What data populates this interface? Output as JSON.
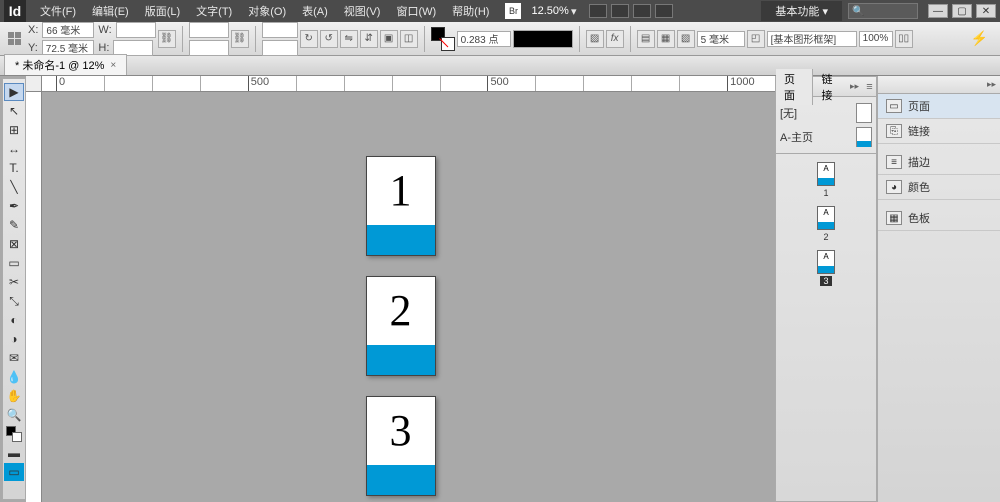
{
  "menubar": {
    "logo": "Id",
    "items": [
      "文件(F)",
      "编辑(E)",
      "版面(L)",
      "文字(T)",
      "对象(O)",
      "表(A)",
      "视图(V)",
      "窗口(W)",
      "帮助(H)"
    ],
    "zoom": "12.50%",
    "workspace": "基本功能",
    "search_placeholder": "🔍"
  },
  "controlbar": {
    "x_label": "X:",
    "x_value": "66 毫米",
    "y_label": "Y:",
    "y_value": "72.5 毫米",
    "w_label": "W:",
    "w_value": "",
    "h_label": "H:",
    "h_value": "",
    "stroke_weight": "0.283 点",
    "opacity": "100%",
    "gap": "5 毫米",
    "style": "[基本图形框架]"
  },
  "tab": {
    "title": "* 未命名-1 @ 12%",
    "close": "×"
  },
  "ruler_labels": [
    "0",
    "500",
    "1000"
  ],
  "canvas_pages": [
    {
      "num": "1"
    },
    {
      "num": "2"
    },
    {
      "num": "3"
    }
  ],
  "pages_panel": {
    "tabs": [
      "页面",
      "链接"
    ],
    "masters": [
      {
        "label": "[无]",
        "band": false
      },
      {
        "label": "A-主页",
        "band": true
      }
    ],
    "thumbs": [
      {
        "letter": "A",
        "label": "1",
        "selected": false
      },
      {
        "letter": "A",
        "label": "2",
        "selected": false
      },
      {
        "letter": "A",
        "label": "3",
        "selected": true
      }
    ]
  },
  "collapsed_panels": {
    "items": [
      {
        "icon": "▭",
        "label": "页面",
        "active": true
      },
      {
        "icon": "⎘",
        "label": "链接",
        "active": false
      }
    ],
    "items2": [
      {
        "icon": "≡",
        "label": "描边"
      },
      {
        "icon": "◕",
        "label": "颜色"
      }
    ],
    "items3": [
      {
        "icon": "▦",
        "label": "色板"
      }
    ]
  },
  "tools": [
    "▸",
    "↖",
    "✎",
    "T",
    "╱",
    "▭",
    "▭",
    "✂",
    "◐",
    "✥",
    "◳",
    "✋",
    "🔍",
    "◧",
    "◨",
    "▦",
    "◫"
  ]
}
